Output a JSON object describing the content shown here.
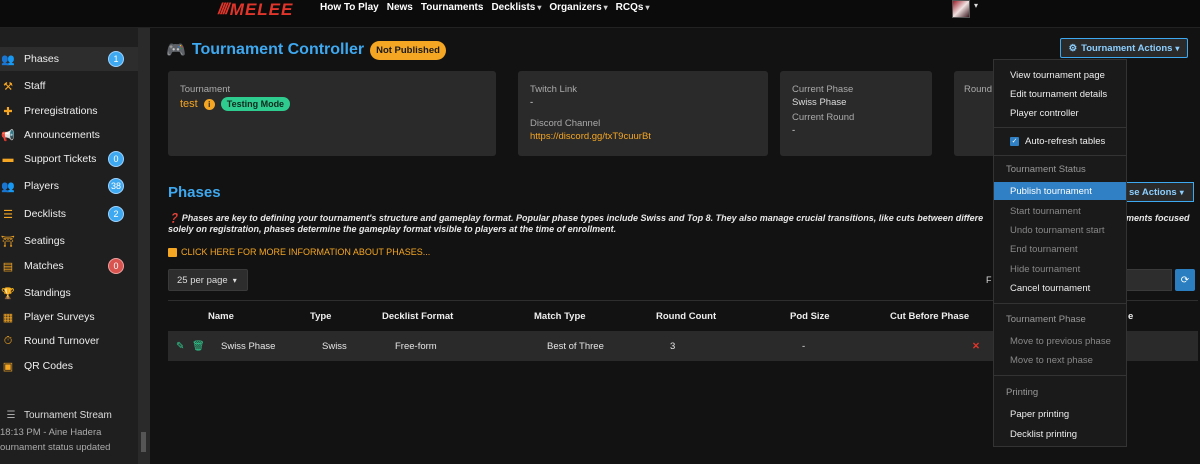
{
  "brand": {
    "bars": "////",
    "name": "MELEE"
  },
  "nav": [
    {
      "label": "How To Play",
      "dropdown": false
    },
    {
      "label": "News",
      "dropdown": false
    },
    {
      "label": "Tournaments",
      "dropdown": false
    },
    {
      "label": "Decklists",
      "dropdown": true
    },
    {
      "label": "Organizers",
      "dropdown": true
    },
    {
      "label": "RCQs",
      "dropdown": true
    }
  ],
  "sidebar": {
    "items": [
      {
        "label": "Phases",
        "icon": "users-icon",
        "badge": "1"
      },
      {
        "label": "Staff",
        "icon": "staff-icon",
        "badge": ""
      },
      {
        "label": "Preregistrations",
        "icon": "user-plus-icon",
        "badge": ""
      },
      {
        "label": "Announcements",
        "icon": "megaphone-icon",
        "badge": ""
      },
      {
        "label": "Support Tickets",
        "icon": "ticket-icon",
        "badge": "0"
      },
      {
        "label": "Players",
        "icon": "players-icon",
        "badge": "38"
      },
      {
        "label": "Decklists",
        "icon": "list-icon",
        "badge": "2"
      },
      {
        "label": "Seatings",
        "icon": "chair-icon",
        "badge": ""
      },
      {
        "label": "Matches",
        "icon": "clipboard-icon",
        "badge": "0"
      },
      {
        "label": "Standings",
        "icon": "trophy-icon",
        "badge": ""
      },
      {
        "label": "Player Surveys",
        "icon": "survey-icon",
        "badge": ""
      },
      {
        "label": "Round Turnover",
        "icon": "stopwatch-icon",
        "badge": ""
      },
      {
        "label": "QR Codes",
        "icon": "qr-icon",
        "badge": ""
      }
    ],
    "stream_title": "Tournament Stream",
    "stream_lines": [
      "18:13 PM - Aine Hadera",
      "ournament status updated"
    ]
  },
  "header": {
    "title": "Tournament Controller",
    "status": "Not Published",
    "actions_label": "Tournament Actions"
  },
  "cards": {
    "tournament_label": "Tournament",
    "tournament_name": "test",
    "mode": "Testing Mode",
    "twitch_label": "Twitch Link",
    "twitch_value": "-",
    "discord_label": "Discord Channel",
    "discord_value": "https://discord.gg/txT9cuurBt",
    "phase_label": "Current Phase",
    "phase_value": "Swiss Phase",
    "round_label": "Current Round",
    "round_value": "-",
    "extra_label": "Round"
  },
  "phases": {
    "title": "Phases",
    "actions_label": "se Actions",
    "description": "Phases are key to defining your tournament's structure and gameplay format. Popular phase types include Swiss and Top 8. They also manage crucial transitions, like cuts between differe",
    "description_end": "ments focused",
    "description_line2": "solely on registration, phases determine the gameplay format visible to players at the time of enrollment.",
    "more_link": "CLICK HERE FOR MORE INFORMATION ABOUT PHASES...",
    "per_page": "25 per page",
    "filter_label": "F",
    "columns": [
      "Name",
      "Type",
      "Decklist Format",
      "Match Type",
      "Round Count",
      "Pod Size",
      "Cut Before Phase",
      "e"
    ],
    "rows": [
      {
        "name": "Swiss Phase",
        "type": "Swiss",
        "format": "Free-form",
        "match": "Best of Three",
        "rounds": "3",
        "pod": "-",
        "cut": "✕"
      }
    ]
  },
  "dropdown": {
    "view": "View tournament page",
    "edit": "Edit tournament details",
    "player": "Player controller",
    "autorefresh": "Auto-refresh tables",
    "status_head": "Tournament Status",
    "publish": "Publish tournament",
    "start": "Start tournament",
    "undo": "Undo tournament start",
    "end": "End tournament",
    "hide": "Hide tournament",
    "cancel": "Cancel tournament",
    "phase_head": "Tournament Phase",
    "prev": "Move to previous phase",
    "next": "Move to next phase",
    "print_head": "Printing",
    "paper": "Paper printing",
    "decklist": "Decklist printing"
  },
  "colors": {
    "accent": "#3ea8f0",
    "brand": "#e0352b",
    "warning": "#f5a623",
    "success": "#2ecc8f"
  }
}
